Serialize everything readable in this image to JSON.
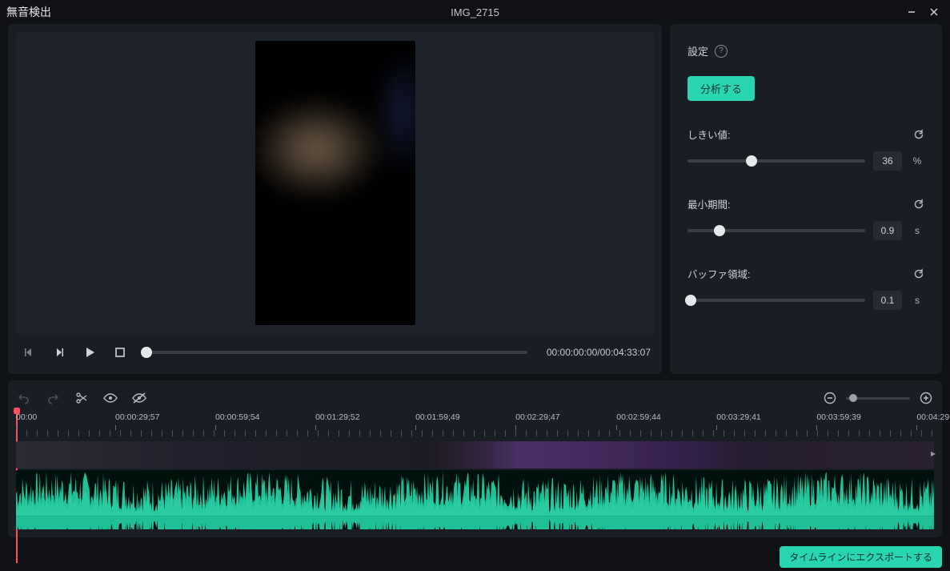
{
  "window": {
    "title_left": "無音検出",
    "title_center": "IMG_2715"
  },
  "transport": {
    "time": "00:00:00:00/00:04:33:07"
  },
  "side": {
    "settings_label": "設定",
    "analyze_label": "分析する",
    "threshold": {
      "label": "しきい値:",
      "value": "36",
      "unit": "%",
      "percent": 36
    },
    "min_dur": {
      "label": "最小期間:",
      "value": "0.9",
      "unit": "s",
      "percent": 18
    },
    "buffer": {
      "label": "バッファ領域:",
      "value": "0.1",
      "unit": "s",
      "percent": 2
    }
  },
  "ruler": {
    "ticks": [
      {
        "label": "00:00",
        "left_pct": 0
      },
      {
        "label": "00:00:29;57",
        "left_pct": 10.9
      },
      {
        "label": "00:00:59;54",
        "left_pct": 21.8
      },
      {
        "label": "00:01:29;52",
        "left_pct": 32.7
      },
      {
        "label": "00:01:59;49",
        "left_pct": 43.6
      },
      {
        "label": "00:02:29;47",
        "left_pct": 54.5
      },
      {
        "label": "00:02:59;44",
        "left_pct": 65.5
      },
      {
        "label": "00:03:29;41",
        "left_pct": 76.4
      },
      {
        "label": "00:03:59;39",
        "left_pct": 87.3
      },
      {
        "label": "00:04:29",
        "left_pct": 98.2
      }
    ]
  },
  "footer": {
    "export_label": "タイムラインにエクスポートする"
  }
}
